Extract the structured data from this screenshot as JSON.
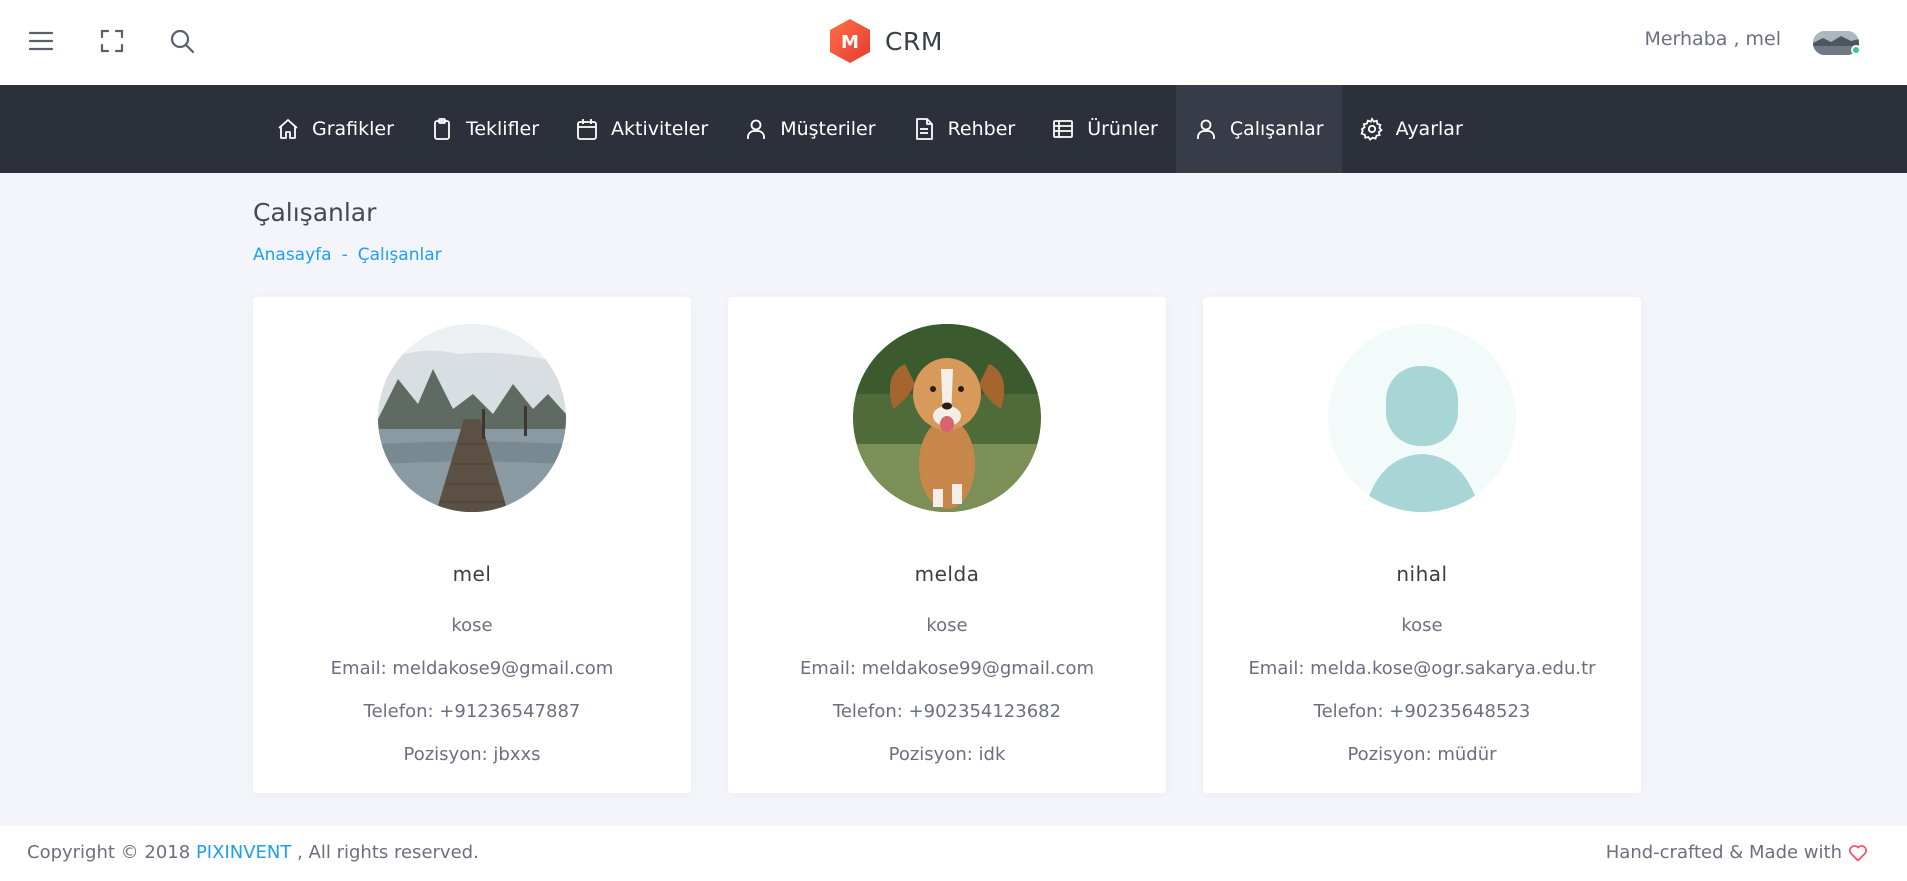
{
  "header": {
    "brand_letter": "M",
    "brand_name": "CRM",
    "greeting": "Merhaba , mel",
    "icons": [
      "menu-icon",
      "fullscreen-icon",
      "search-icon"
    ],
    "brand_color": "#f04b3f"
  },
  "nav": {
    "items": [
      {
        "label": "Grafikler",
        "icon": "home-icon"
      },
      {
        "label": "Teklifler",
        "icon": "clipboard-icon"
      },
      {
        "label": "Aktiviteler",
        "icon": "calendar-icon"
      },
      {
        "label": "Müşteriler",
        "icon": "user-icon"
      },
      {
        "label": "Rehber",
        "icon": "document-icon"
      },
      {
        "label": "Ürünler",
        "icon": "list-icon"
      },
      {
        "label": "Çalışanlar",
        "icon": "user-icon",
        "active": true
      },
      {
        "label": "Ayarlar",
        "icon": "gear-icon"
      }
    ]
  },
  "page": {
    "title": "Çalışanlar",
    "breadcrumb": [
      "Anasayfa",
      "Çalışanlar"
    ],
    "breadcrumb_separator": "-"
  },
  "employees": [
    {
      "name": "mel",
      "surname": "kose",
      "email": "Email: meldakose9@gmail.com",
      "phone": "Telefon: +91236547887",
      "position": "Pozisyon: jbxxs",
      "photo": "lake-pier-photo"
    },
    {
      "name": "melda",
      "surname": "kose",
      "email": "Email: meldakose99@gmail.com",
      "phone": "Telefon: +902354123682",
      "position": "Pozisyon: idk",
      "photo": "running-dog-photo"
    },
    {
      "name": "nihal",
      "surname": "kose",
      "email": "Email: melda.kose@ogr.sakarya.edu.tr",
      "phone": "Telefon: +90235648523",
      "position": "Pozisyon: müdür",
      "photo": "default-user-placeholder"
    }
  ],
  "footer": {
    "copyright_prefix": "Copyright © 2018",
    "company": "PIXINVENT",
    "copyright_suffix": ", All rights reserved.",
    "made_with": "Hand-crafted & Made with"
  },
  "colors": {
    "nav_bg": "#2c303b",
    "nav_active_bg": "#383c49",
    "link": "#1e9ff2",
    "heart": "#ff4961",
    "placeholder_bg": "#f3fafa",
    "placeholder_figure": "#a8d5d5"
  }
}
